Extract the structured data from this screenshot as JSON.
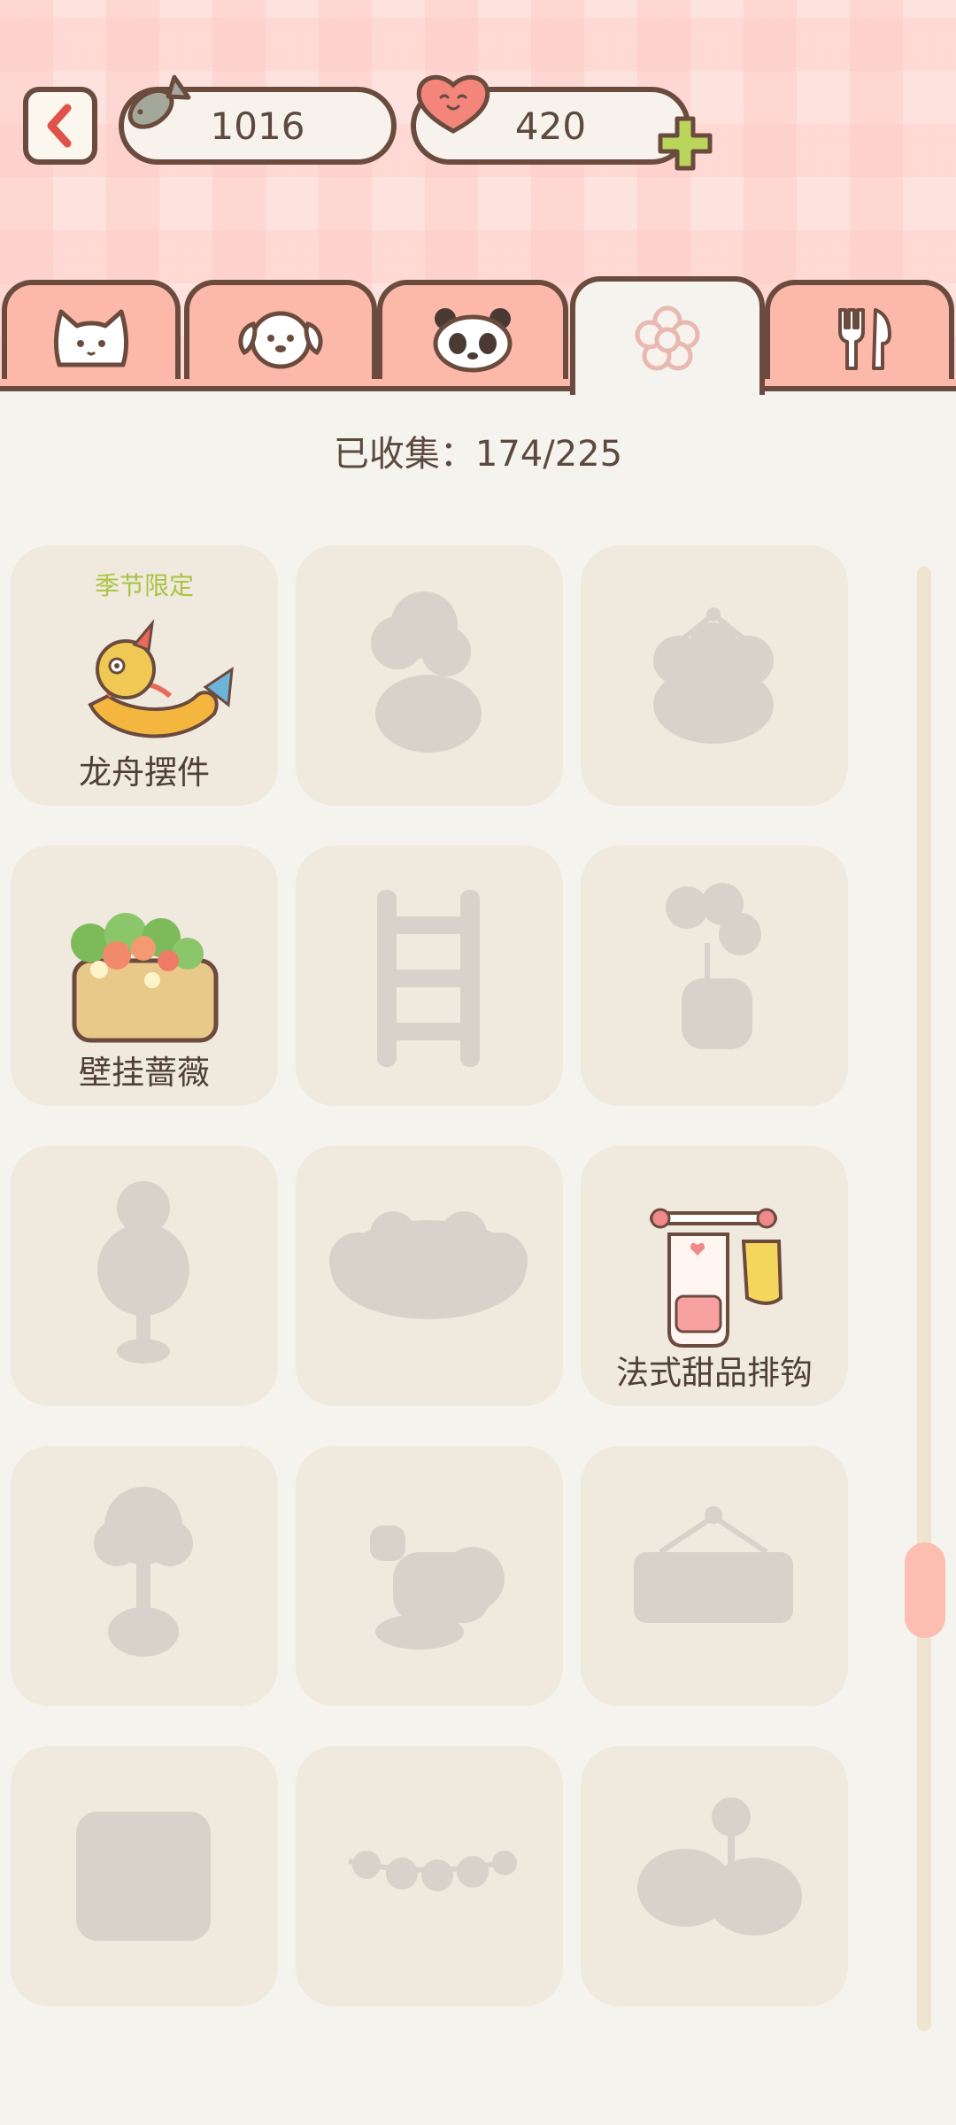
{
  "currency": {
    "fish": "1016",
    "hearts": "420"
  },
  "icons": {
    "back": "chevron-left-icon",
    "fish": "fish-icon",
    "heart": "heart-icon",
    "plus": "plus-icon"
  },
  "tabs": [
    {
      "icon": "cat-icon",
      "active": false
    },
    {
      "icon": "dog-icon",
      "active": false
    },
    {
      "icon": "panda-icon",
      "active": false
    },
    {
      "icon": "flower-icon",
      "active": true
    },
    {
      "icon": "utensils-icon",
      "active": false
    }
  ],
  "collection": {
    "counter": "已收集：174/225"
  },
  "items": [
    {
      "name": "龙舟摆件",
      "tag": "季节限定",
      "unlocked": true
    },
    {
      "name": "",
      "tag": "",
      "unlocked": false
    },
    {
      "name": "",
      "tag": "",
      "unlocked": false
    },
    {
      "name": "壁挂蔷薇",
      "tag": "",
      "unlocked": true
    },
    {
      "name": "",
      "tag": "",
      "unlocked": false
    },
    {
      "name": "",
      "tag": "",
      "unlocked": false
    },
    {
      "name": "",
      "tag": "",
      "unlocked": false
    },
    {
      "name": "",
      "tag": "",
      "unlocked": false
    },
    {
      "name": "法式甜品排钩",
      "tag": "",
      "unlocked": true
    },
    {
      "name": "",
      "tag": "",
      "unlocked": false
    },
    {
      "name": "",
      "tag": "",
      "unlocked": false
    },
    {
      "name": "",
      "tag": "",
      "unlocked": false
    },
    {
      "name": "",
      "tag": "",
      "unlocked": false
    },
    {
      "name": "",
      "tag": "",
      "unlocked": false
    },
    {
      "name": "",
      "tag": "",
      "unlocked": false
    }
  ],
  "colors": {
    "accent": "#fcb9aa",
    "outline": "#6b4b3e",
    "card": "#efe9de",
    "silhouette": "#d8d3ca",
    "seasonal": "#a8c441"
  }
}
